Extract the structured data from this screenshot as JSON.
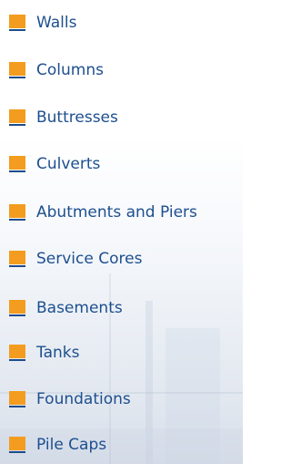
{
  "menu": {
    "items": [
      {
        "label": "Walls",
        "icon": "orange-square-bullet-icon"
      },
      {
        "label": "Columns",
        "icon": "orange-square-bullet-icon"
      },
      {
        "label": "Buttresses",
        "icon": "orange-square-bullet-icon"
      },
      {
        "label": "Culverts",
        "icon": "orange-square-bullet-icon"
      },
      {
        "label": "Abutments and Piers",
        "icon": "orange-square-bullet-icon"
      },
      {
        "label": "Service Cores",
        "icon": "orange-square-bullet-icon"
      },
      {
        "label": "Basements",
        "icon": "orange-square-bullet-icon"
      },
      {
        "label": "Tanks",
        "icon": "orange-square-bullet-icon"
      },
      {
        "label": "Foundations",
        "icon": "orange-square-bullet-icon"
      },
      {
        "label": "Pile Caps",
        "icon": "orange-square-bullet-icon"
      }
    ]
  },
  "colors": {
    "bullet_fill": "#f39c1f",
    "bullet_underline": "#1e4c8c",
    "label_text": "#1d4f8f"
  }
}
